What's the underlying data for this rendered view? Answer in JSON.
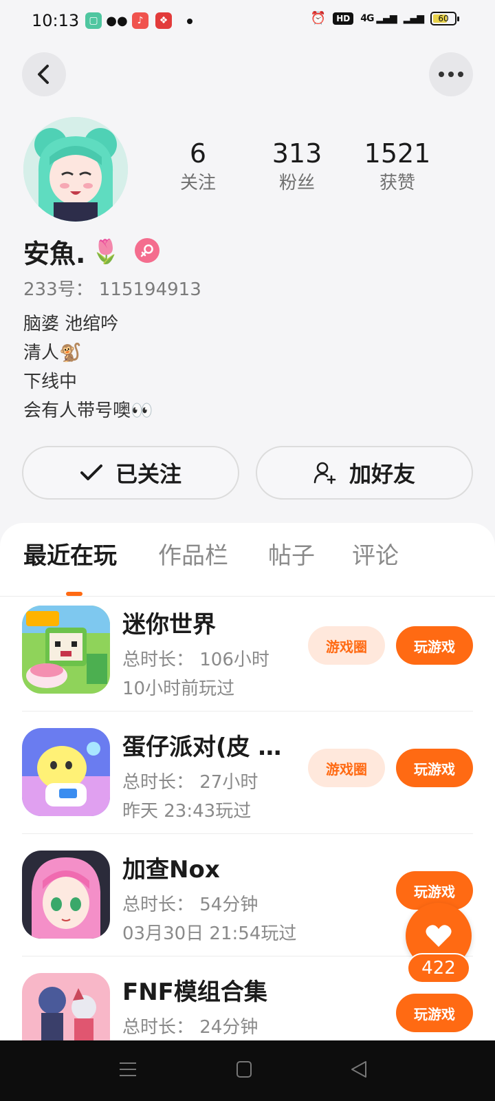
{
  "status_bar": {
    "time": "10:13",
    "network": "4G",
    "battery": "60"
  },
  "profile": {
    "nickname": "安魚.",
    "nickname_emoji": "🌷",
    "uid": "233号： 115194913",
    "bio_lines": [
      "脑婆 池绾吟",
      "清人🐒",
      "下线中",
      "会有人带号噢👀"
    ],
    "stats": {
      "following": {
        "value": "6",
        "label": "关注"
      },
      "fans": {
        "value": "313",
        "label": "粉丝"
      },
      "likes": {
        "value": "1521",
        "label": "获赞"
      }
    }
  },
  "actions": {
    "follow_label": "已关注",
    "add_friend_label": "加好友"
  },
  "tabs": [
    "最近在玩",
    "作品栏",
    "帖子",
    "评论"
  ],
  "games": [
    {
      "name": "迷你世界",
      "duration": "总时长： 106小时",
      "last_played": "10小时前玩过",
      "circle_label": "游戏圈",
      "play_label": "玩游戏",
      "icon": "mini-world-icon"
    },
    {
      "name": "蛋仔派对(皮 …",
      "duration": "总时长： 27小时",
      "last_played": "昨天 23:43玩过",
      "circle_label": "游戏圈",
      "play_label": "玩游戏",
      "icon": "eggy-party-icon"
    },
    {
      "name": "加查Nox",
      "duration": "总时长： 54分钟",
      "last_played": "03月30日 21:54玩过",
      "play_label": "玩游戏",
      "icon": "gacha-nox-icon"
    },
    {
      "name": "FNF模组合集",
      "duration": "总时长： 24分钟",
      "last_played": "",
      "play_label": "玩游戏",
      "icon": "fnf-icon"
    }
  ],
  "like_fab": {
    "count": "422"
  },
  "colors": {
    "accent": "#ff6a13",
    "accent_light": "#ffe8dc",
    "gender": "#f46d8e"
  }
}
